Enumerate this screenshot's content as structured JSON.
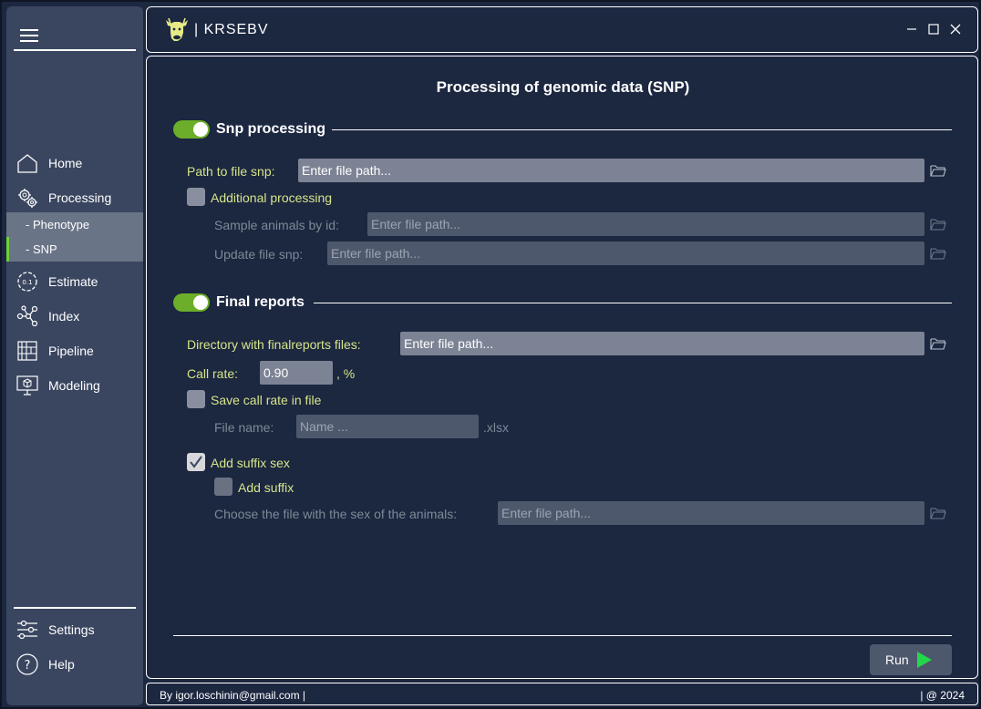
{
  "app": {
    "title": "KRSEBV",
    "logo_icon": "cow-icon"
  },
  "window_controls": {
    "minimize": "minimize-icon",
    "maximize": "maximize-icon",
    "close": "close-icon"
  },
  "sidebar": {
    "menu_icon": "hamburger-icon",
    "items": [
      {
        "label": "Home",
        "icon": "home-icon"
      },
      {
        "label": "Processing",
        "icon": "gears-icon"
      },
      {
        "label": "- Phenotype",
        "sub": true
      },
      {
        "label": "- SNP",
        "sub": true,
        "active": true
      },
      {
        "label": "Estimate",
        "icon": "estimate-icon"
      },
      {
        "label": "Index",
        "icon": "network-icon"
      },
      {
        "label": "Pipeline",
        "icon": "pipeline-icon"
      },
      {
        "label": "Modeling",
        "icon": "modeling-icon"
      }
    ],
    "bottom_items": [
      {
        "label": "Settings",
        "icon": "sliders-icon"
      },
      {
        "label": "Help",
        "icon": "help-icon"
      }
    ]
  },
  "main": {
    "title": "Processing of genomic data (SNP)",
    "snp_section": {
      "title": "Snp processing",
      "enabled": true,
      "path_label": "Path to file snp:",
      "path_placeholder": "Enter file path...",
      "additional_label": "Additional processing",
      "sample_label": "Sample animals by id:",
      "sample_placeholder": "Enter file path...",
      "update_label": "Update file snp:",
      "update_placeholder": "Enter file path..."
    },
    "final_section": {
      "title": "Final reports",
      "enabled": true,
      "dir_label": "Directory with finalreports files:",
      "dir_placeholder": "Enter file path...",
      "call_rate_label": "Call rate:",
      "call_rate_value": "0.90",
      "call_rate_unit": ", %",
      "save_label": "Save call rate in file",
      "file_name_label": "File name:",
      "file_name_placeholder": "Name ...",
      "file_ext": ".xlsx",
      "suffix_sex_label": "Add suffix sex",
      "suffix_sex_checked": true,
      "add_suffix_label": "Add suffix",
      "sex_file_label": "Choose the file with the sex of the animals:",
      "sex_file_placeholder": "Enter file path..."
    },
    "run_label": "Run"
  },
  "status": {
    "left": "By igor.loschinin@gmail.com |",
    "right": "| @ 2024"
  },
  "colors": {
    "accent": "#6cae2a",
    "label_active": "#d6e58a",
    "label_disabled": "#7c8a96",
    "background": "#1c2740",
    "sidebar": "#3a4660"
  }
}
